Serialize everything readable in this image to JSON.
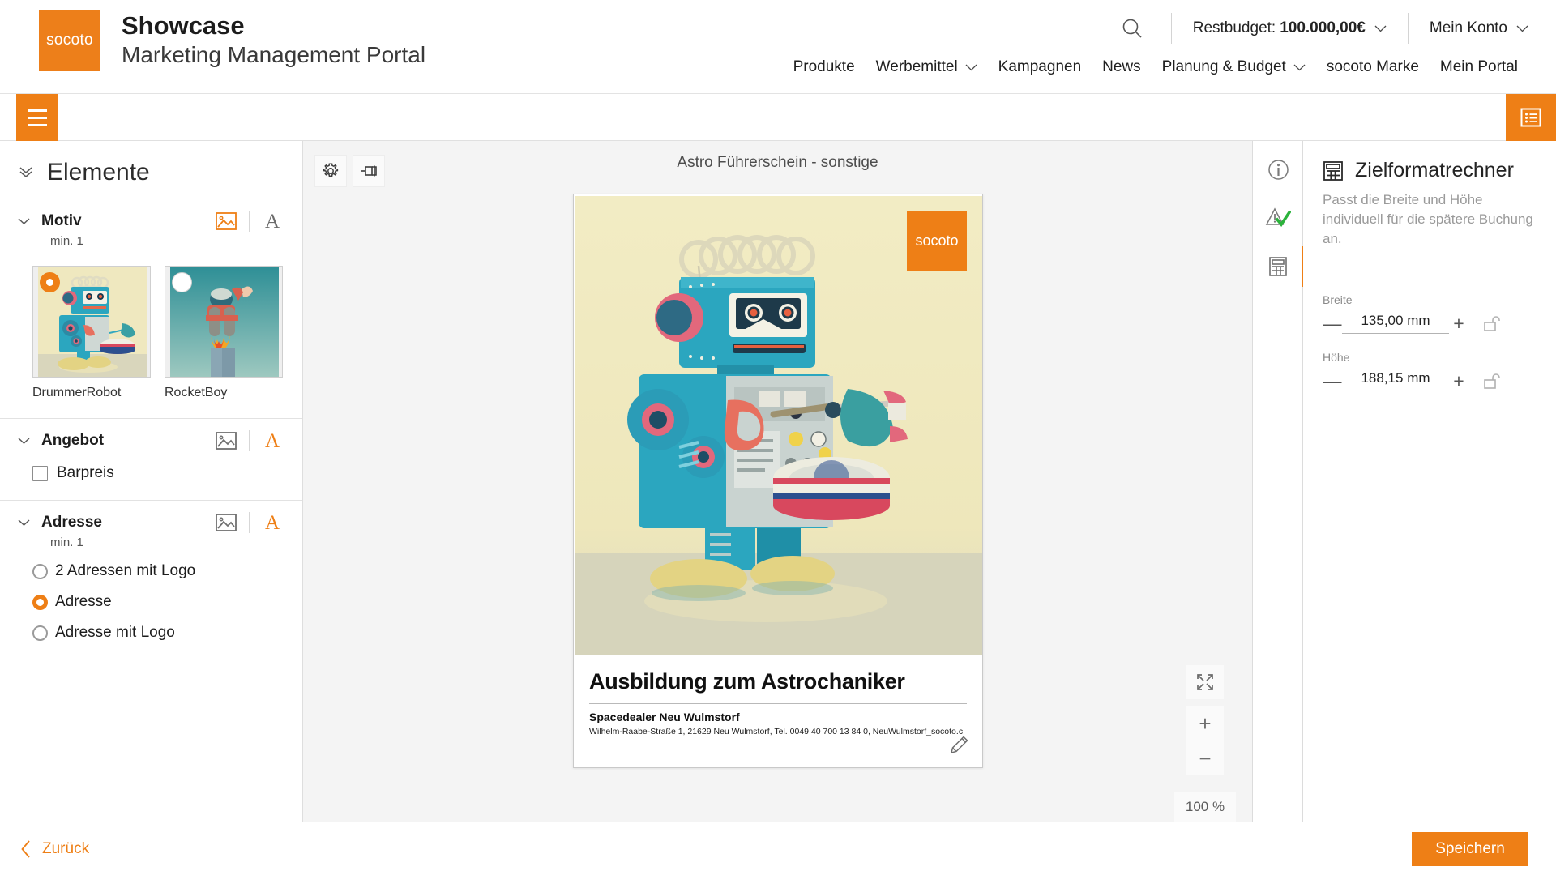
{
  "header": {
    "logo_text": "socoto",
    "title": "Showcase",
    "subtitle": "Marketing Management Portal",
    "search_icon": "search-icon",
    "budget_label": "Restbudget:",
    "budget_value": "100.000,00€",
    "account_label": "Mein Konto",
    "nav": [
      {
        "label": "Produkte",
        "has_chevron": false
      },
      {
        "label": "Werbemittel",
        "has_chevron": true
      },
      {
        "label": "Kampagnen",
        "has_chevron": false
      },
      {
        "label": "News",
        "has_chevron": false
      },
      {
        "label": "Planung & Budget",
        "has_chevron": true
      },
      {
        "label": "socoto Marke",
        "has_chevron": false
      },
      {
        "label": "Mein Portal",
        "has_chevron": false
      }
    ]
  },
  "strip": {
    "menu_icon": "hamburger-menu-icon",
    "panel_icon": "list-panel-icon"
  },
  "sidebar": {
    "heading": "Elemente",
    "groups": [
      {
        "title": "Motiv",
        "min_label": "min. 1",
        "image_icon_active": true,
        "text_icon_active": false,
        "type": "thumbnails",
        "items": [
          {
            "label": "DrummerRobot",
            "selected": true
          },
          {
            "label": "RocketBoy",
            "selected": false
          }
        ]
      },
      {
        "title": "Angebot",
        "min_label": "",
        "image_icon_active": false,
        "text_icon_active": true,
        "type": "checkbox",
        "items": [
          {
            "label": "Barpreis",
            "selected": false
          }
        ]
      },
      {
        "title": "Adresse",
        "min_label": "min. 1",
        "image_icon_active": false,
        "text_icon_active": true,
        "type": "radio",
        "items": [
          {
            "label": "2 Adressen mit Logo",
            "selected": false
          },
          {
            "label": "Adresse",
            "selected": true
          },
          {
            "label": "Adresse mit Logo",
            "selected": false
          }
        ]
      }
    ]
  },
  "canvas": {
    "tools": [
      {
        "name": "settings-gear-icon"
      },
      {
        "name": "pin-flag-icon"
      }
    ],
    "document_title": "Astro Führerschein - sonstige",
    "page": {
      "badge_text": "socoto",
      "headline": "Ausbildung zum Astrochaniker",
      "dealer": "Spacedealer Neu Wulmstorf",
      "address": "Wilhelm-Raabe-Straße 1, 21629 Neu Wulmstorf, Tel. 0049 40 700 13 84 0, NeuWulmstorf_socoto.c",
      "edit_icon": "pencil-edit-icon"
    },
    "zoom": {
      "fit_icon": "fit-to-screen-icon",
      "zoom_in": "+",
      "zoom_out": "−",
      "level": "100 %"
    }
  },
  "right_panel": {
    "rail": [
      {
        "name": "info-icon",
        "active": false
      },
      {
        "name": "warning-check-icon",
        "active": false
      },
      {
        "name": "calculator-icon",
        "active": true
      }
    ],
    "title": "Zielformatrechner",
    "title_icon": "calculator-icon",
    "description": "Passt die Breite und Höhe individuell für die spätere Buchung an.",
    "fields": [
      {
        "label": "Breite",
        "value": "135,00 mm",
        "minus": "—",
        "plus": "+",
        "lock_icon": "unlock-icon"
      },
      {
        "label": "Höhe",
        "value": "188,15 mm",
        "minus": "—",
        "plus": "+",
        "lock_icon": "unlock-icon"
      }
    ]
  },
  "footer": {
    "back_label": "Zurück",
    "back_icon": "chevron-left-icon",
    "save_label": "Speichern"
  },
  "colors": {
    "brand_orange": "#ee7f16",
    "success_green": "#2bb33b"
  }
}
